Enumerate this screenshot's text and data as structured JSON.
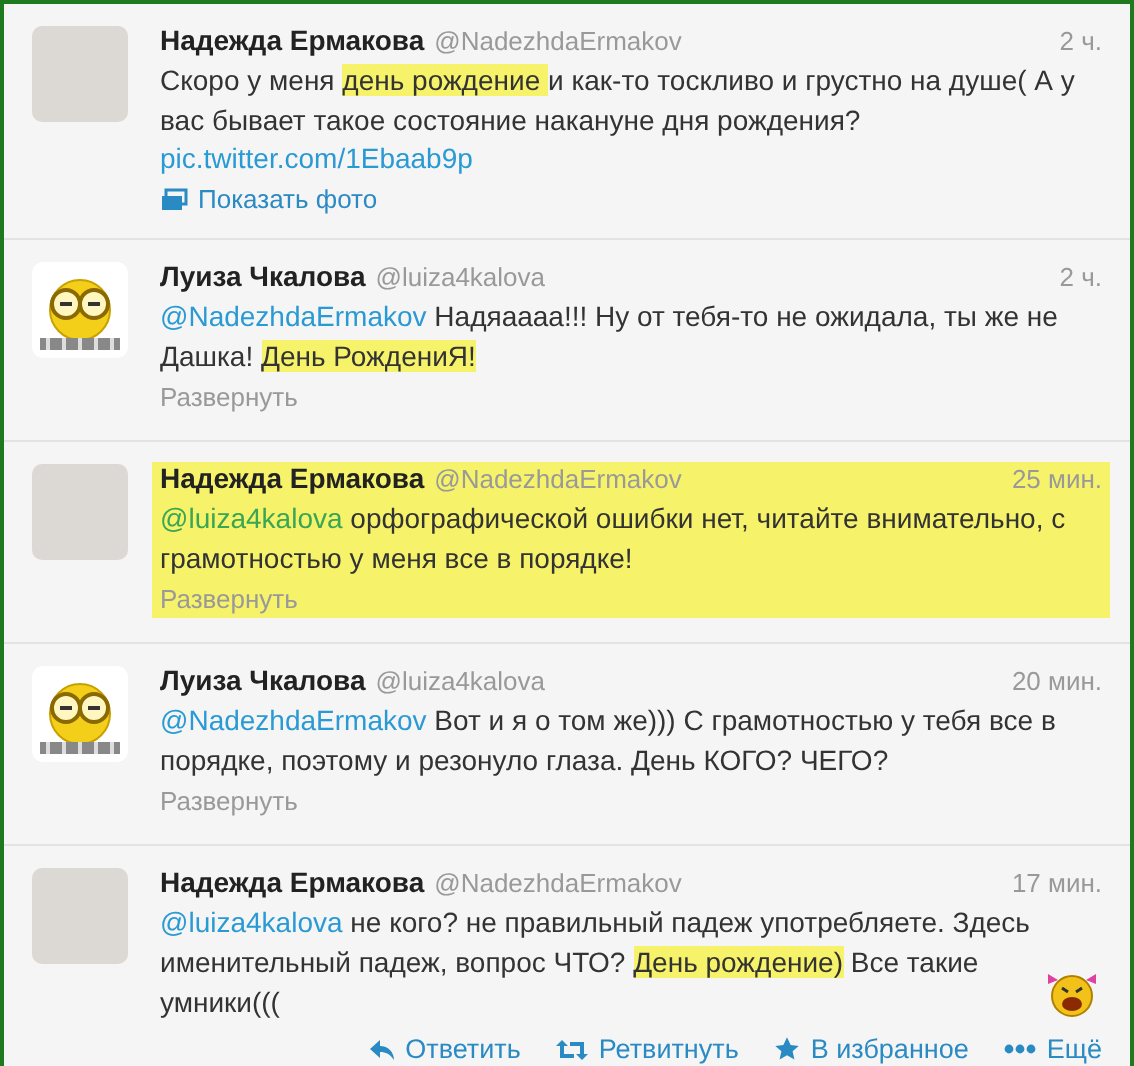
{
  "tweets": [
    {
      "name": "Надежда Ермакова",
      "handle": "@NadezhdaErmakov",
      "time": "2 ч.",
      "avatar": {
        "kind": "photo"
      },
      "highlighted": false,
      "segments": [
        {
          "kind": "text",
          "text": "Скоро у меня "
        },
        {
          "kind": "highlight",
          "text": "день рождение "
        },
        {
          "kind": "text",
          "text": "и как-то тоскливо и грустно на душе( А у вас бывает такое состояние накануне дня рождения?"
        }
      ],
      "link": "pic.twitter.com/1Ebaab9p",
      "emoticon": false,
      "footer": {
        "kind": "photo",
        "label": "Показать фото"
      }
    },
    {
      "name": "Луиза Чкалова",
      "handle": "@luiza4kalova",
      "time": "2 ч.",
      "avatar": {
        "kind": "smiley"
      },
      "highlighted": false,
      "segments": [
        {
          "kind": "mention",
          "text": "@NadezhdaErmakov"
        },
        {
          "kind": "text",
          "text": " Надяаааа!!! Ну от тебя-то не ожидала, ты же не Дашка! "
        },
        {
          "kind": "highlight",
          "text": "День РождениЯ!"
        }
      ],
      "emoticon": false,
      "footer": {
        "kind": "expand",
        "label": "Развернуть"
      }
    },
    {
      "name": "Надежда Ермакова",
      "handle": "@NadezhdaErmakov",
      "time": "25 мин.",
      "avatar": {
        "kind": "photo"
      },
      "highlighted": true,
      "segments": [
        {
          "kind": "mention",
          "text": "@luiza4kalova"
        },
        {
          "kind": "text",
          "text": " орфографической ошибки нет, читайте внимательно, с грамотностью у меня все в порядке!"
        }
      ],
      "emoticon": false,
      "footer": {
        "kind": "expand",
        "label": "Развернуть"
      }
    },
    {
      "name": "Луиза Чкалова",
      "handle": "@luiza4kalova",
      "time": "20 мин.",
      "avatar": {
        "kind": "smiley"
      },
      "highlighted": false,
      "segments": [
        {
          "kind": "mention",
          "text": "@NadezhdaErmakov"
        },
        {
          "kind": "text",
          "text": " Вот и я о том же))) С грамотностью у тебя все в порядке, поэтому и резонуло глаза. День КОГО? ЧЕГО?"
        }
      ],
      "emoticon": false,
      "footer": {
        "kind": "expand",
        "label": "Развернуть"
      }
    },
    {
      "name": "Надежда Ермакова",
      "handle": "@NadezhdaErmakov",
      "time": "17 мин.",
      "avatar": {
        "kind": "photo"
      },
      "highlighted": false,
      "segments": [
        {
          "kind": "mention",
          "text": "@luiza4kalova"
        },
        {
          "kind": "text",
          "text": " не кого? не правильный падеж употребляете. Здесь именительный падеж, вопрос ЧТО? "
        },
        {
          "kind": "highlight",
          "text": "День рождение)"
        },
        {
          "kind": "text",
          "text": " Все такие умники((("
        }
      ],
      "emoticon": true,
      "footer": {
        "kind": "actions",
        "actions": [
          {
            "kind": "reply",
            "label": "Ответить"
          },
          {
            "kind": "retweet",
            "label": "Ретвитнуть"
          },
          {
            "kind": "favorite",
            "label": "В избранное"
          },
          {
            "kind": "more",
            "label": "Ещё"
          }
        ]
      }
    }
  ]
}
